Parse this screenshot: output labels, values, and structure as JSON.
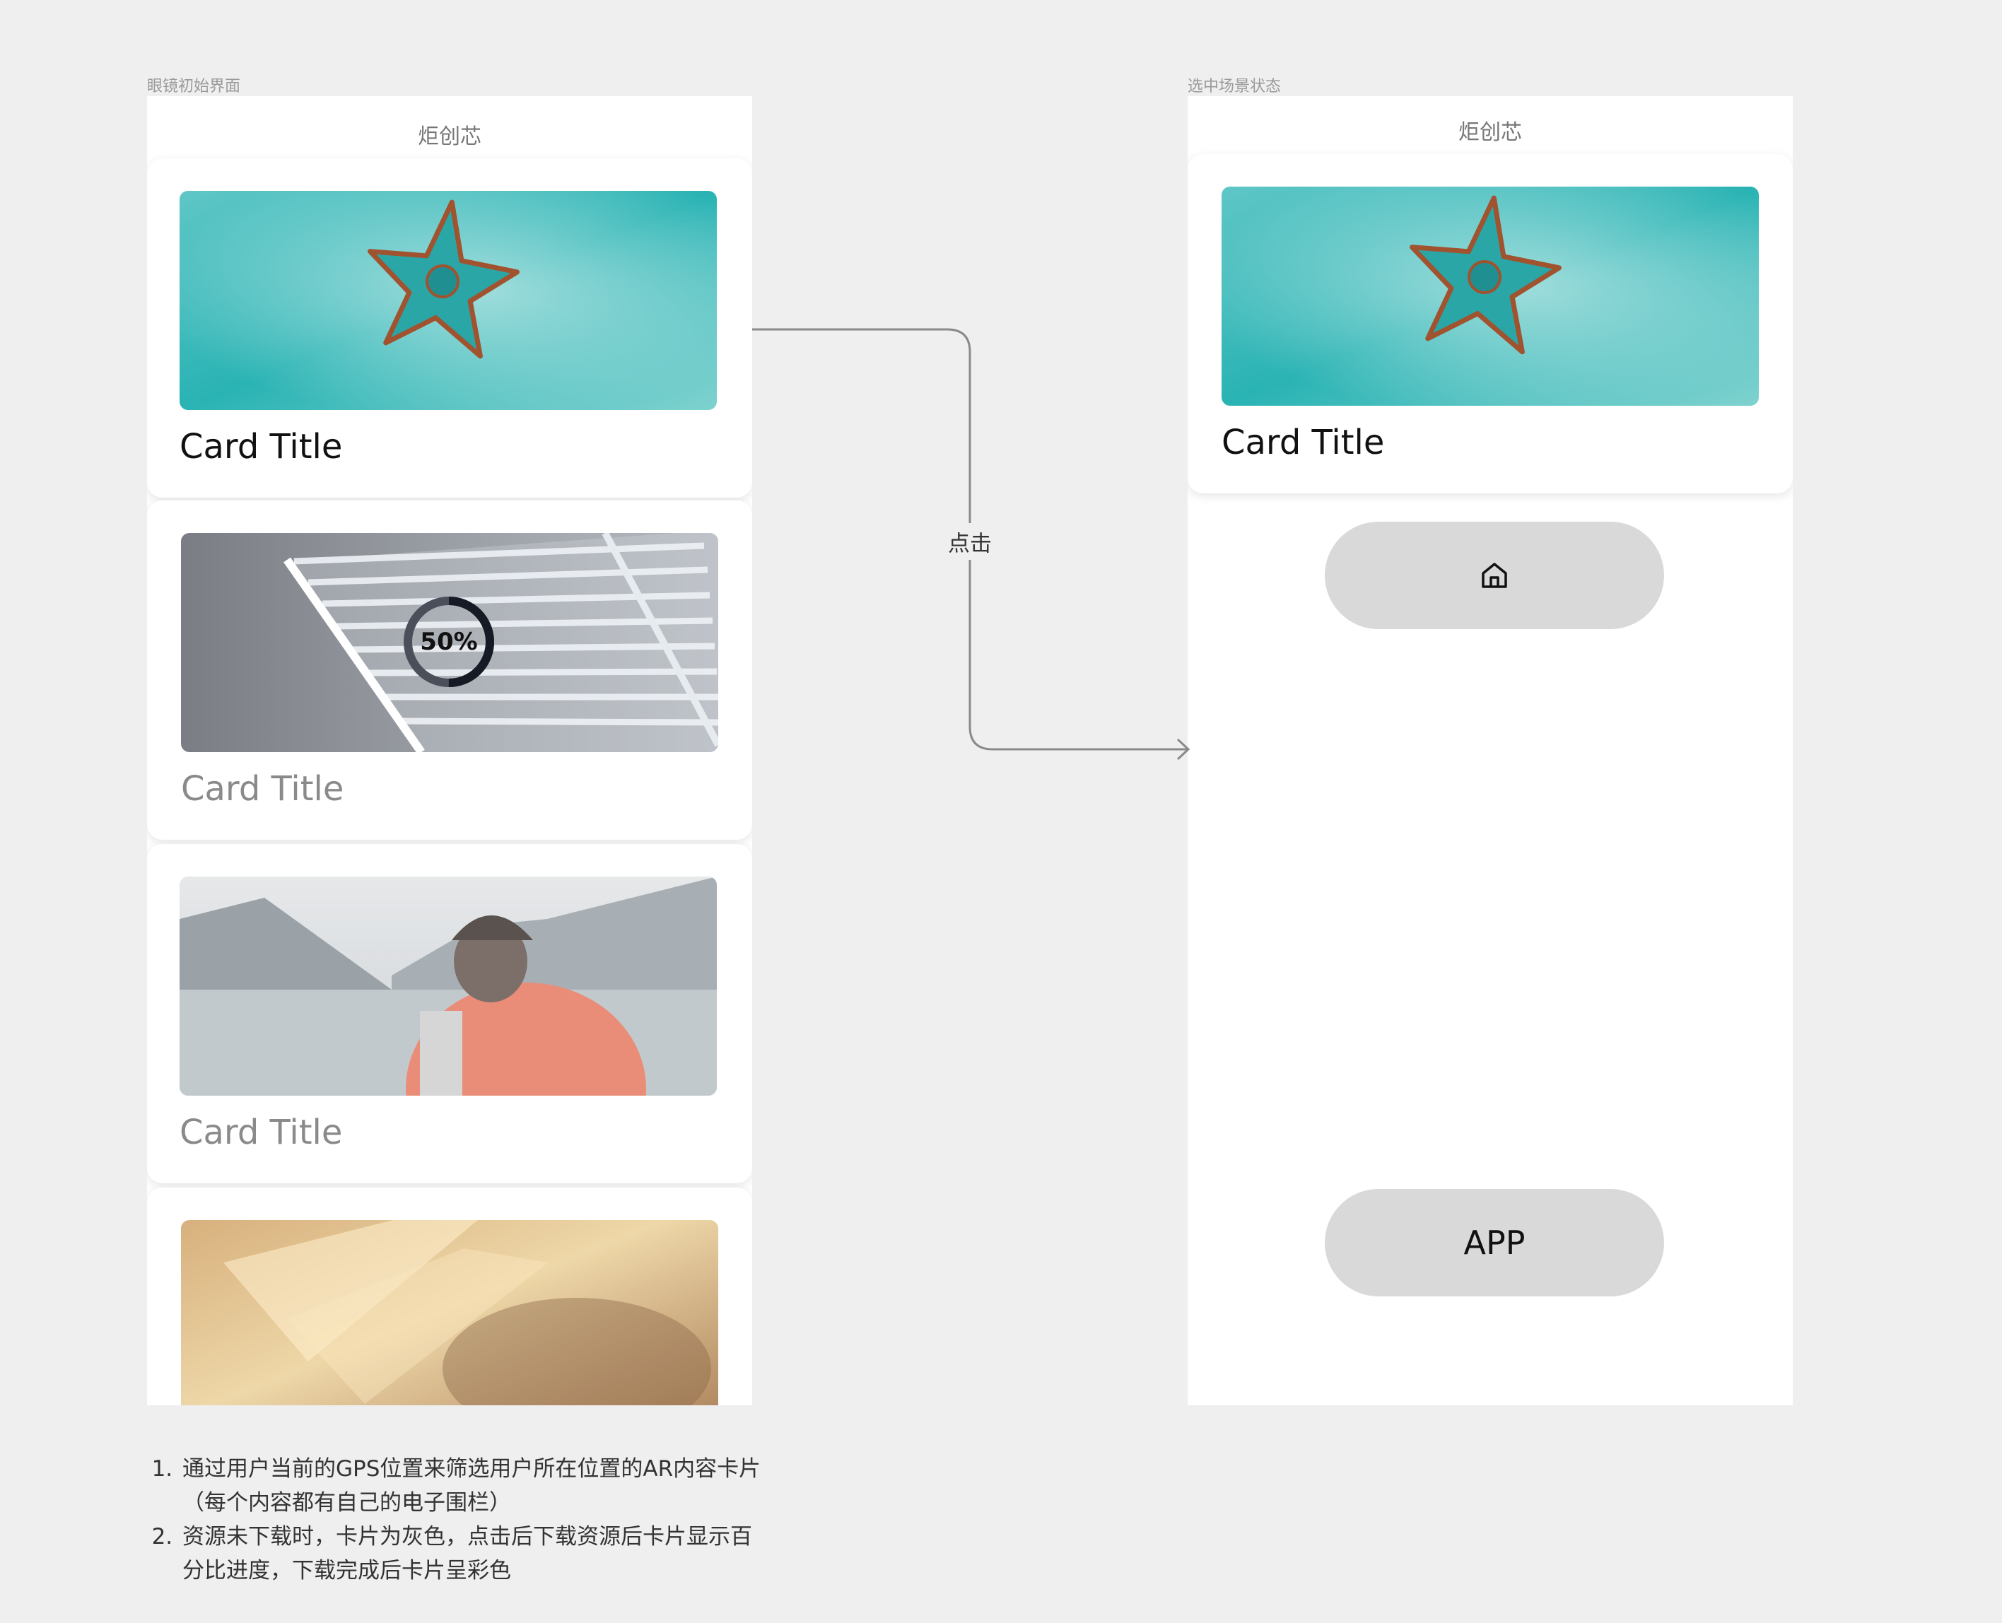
{
  "frames": {
    "left_label": "眼镜初始界面",
    "right_label": "选中场景状态"
  },
  "screen": {
    "title": "炬创芯"
  },
  "cards": [
    {
      "title": "Card Title",
      "image": "starfish-on-teal-sand",
      "state": "colored"
    },
    {
      "title": "Card Title",
      "image": "architecture-structure",
      "state": "gray-downloading",
      "progress_label": "50%",
      "progress": 0.5
    },
    {
      "title": "Card Title",
      "image": "hiker-with-backpack-lake",
      "state": "gray"
    },
    {
      "title": "",
      "image": "golden-light-texture",
      "state": "gray"
    }
  ],
  "selected_card": {
    "title": "Card Title",
    "image": "starfish-on-teal-sand"
  },
  "buttons": {
    "home_icon": "home-icon",
    "app_label": "APP"
  },
  "connector": {
    "label": "点击"
  },
  "notes": [
    "通过用户当前的GPS位置来筛选用户所在位置的AR内容卡片（每个内容都有自己的电子围栏）",
    "资源未下载时，卡片为灰色，点击后下载资源后卡片显示百分比进度，下载完成后卡片呈彩色"
  ],
  "colors": {
    "background": "#efefef",
    "screen": "#ffffff",
    "pill": "#d9d9d9",
    "connector": "#8a8a8a"
  }
}
